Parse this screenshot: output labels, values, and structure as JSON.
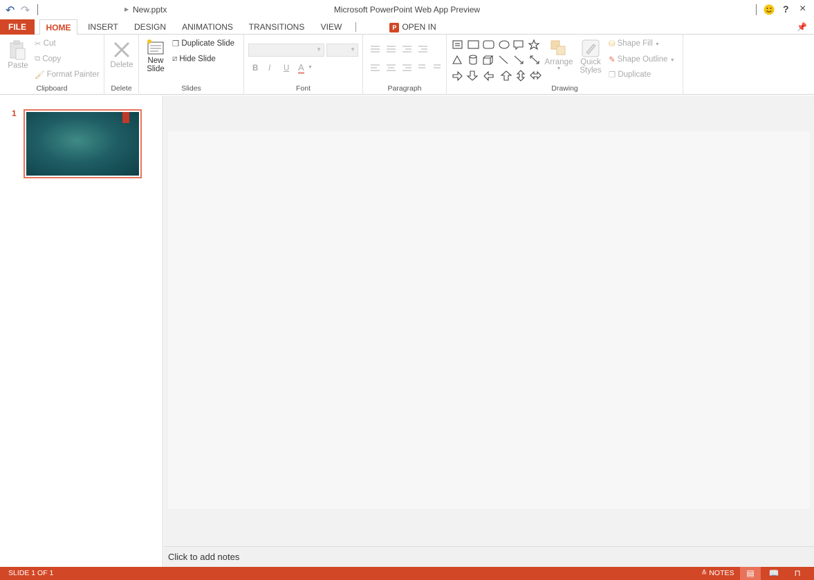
{
  "titlebar": {
    "file_name": "New.pptx",
    "app_title": "Microsoft PowerPoint Web App Preview",
    "undo_icon": "undo-icon",
    "redo_icon": "redo-icon",
    "help": "?",
    "close": "×"
  },
  "tabs": [
    {
      "label": "FILE"
    },
    {
      "label": "HOME"
    },
    {
      "label": "INSERT"
    },
    {
      "label": "DESIGN"
    },
    {
      "label": "ANIMATIONS"
    },
    {
      "label": "TRANSITIONS"
    },
    {
      "label": "VIEW"
    },
    {
      "label": "OPEN IN POWERPOINT"
    }
  ],
  "ribbon": {
    "clipboard": {
      "label": "Clipboard",
      "paste": "Paste",
      "cut": "Cut",
      "copy": "Copy",
      "format_painter": "Format Painter"
    },
    "delete": {
      "label": "Delete",
      "delete": "Delete"
    },
    "slides": {
      "label": "Slides",
      "new_slide_1": "New",
      "new_slide_2": "Slide",
      "duplicate": "Duplicate Slide",
      "hide": "Hide Slide"
    },
    "font": {
      "label": "Font",
      "bold": "B",
      "italic": "I",
      "underline": "U",
      "color": "A"
    },
    "paragraph": {
      "label": "Paragraph"
    },
    "drawing": {
      "label": "Drawing",
      "arrange": "Arrange",
      "quick_1": "Quick",
      "quick_2": "Styles",
      "shape_fill": "Shape Fill",
      "shape_outline": "Shape Outline",
      "duplicate": "Duplicate"
    }
  },
  "thumbnails": {
    "number": "1"
  },
  "notes": {
    "placeholder": "Click to add notes"
  },
  "status": {
    "slide_count": "SLIDE 1 OF 1",
    "notes": "NOTES"
  },
  "colors": {
    "accent": "#d24726",
    "thumb_border": "#e8735a"
  }
}
